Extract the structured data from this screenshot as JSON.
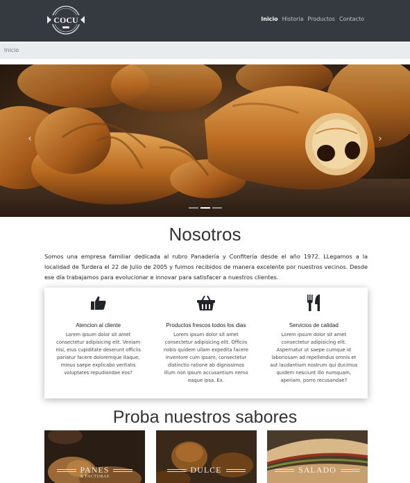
{
  "brand": {
    "logo_text": "COCU"
  },
  "nav": {
    "items": [
      {
        "label": "Inicio"
      },
      {
        "label": "Historia"
      },
      {
        "label": "Productos"
      },
      {
        "label": "Contacto"
      }
    ],
    "active": "Inicio"
  },
  "breadcrumb": {
    "current": "Inicio"
  },
  "carousel": {
    "prev_glyph": "‹",
    "next_glyph": "›",
    "slide_count": 3,
    "active_slide": 2
  },
  "about": {
    "title": "Nosotros",
    "text": "Somos una empresa familiar dedicada al rubro Panadería y Confitería desde el año 1972. LLegamos a la localidad de Turdera el 22 de Julio de 2005 y fuimos recibidos de manera excelente por nuestros vecinos. Desde ese día trabajamos para evolucionar e innovar para satisfacer a nuestros clientes."
  },
  "features": [
    {
      "icon": "thumbs-up-icon",
      "title": "Atencion al cliente",
      "text": "Lorem ipsum dolor sit amet consectetur adipisicing elit. Veniam nisi, eius cupiditate deserunt officiis pariatur facere doloremque itaque, minus saepe explicabo veritatis voluptates repudiandae eos?"
    },
    {
      "icon": "shopping-basket-icon",
      "title": "Productos frescos todos los dias",
      "text": "Lorem ipsum dolor sit amet consectetur adipisicing elit. Officiis nobis quidem ullam expedita facere inventore cum ipsam, consectetur distinctio ratione ab dignissimos illum non ipsum accusantium nemo eaque ipsa. Ex."
    },
    {
      "icon": "utensils-icon",
      "title": "Servicios de calidad",
      "text": "Lorem ipsum dolor sit amet consectetur adipisicing elit. Aspernatur ut saepe cumque id laboriosam ad repellendus omnis et aut laudantium nostrum qui ducimus quidem nesciunt illo numquam, aperiam, porro recusandae?"
    }
  ],
  "products": {
    "title": "Proba nuestros sabores",
    "cards": [
      {
        "label": "PANES",
        "sub": "& FACTURAS"
      },
      {
        "label": "DULCE",
        "sub": ""
      },
      {
        "label": "SALADO",
        "sub": ""
      }
    ]
  },
  "colors": {
    "navbar": "#343a40",
    "breadcrumb": "#e9ecef",
    "text": "#212529"
  }
}
